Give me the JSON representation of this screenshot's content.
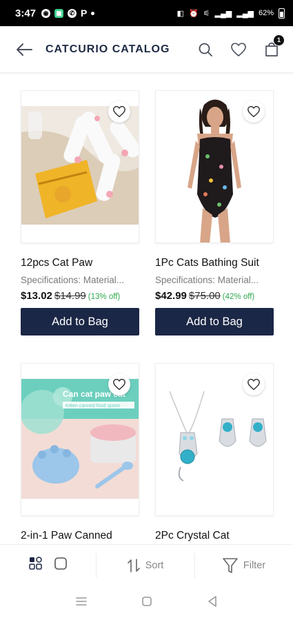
{
  "status_bar": {
    "time": "3:47",
    "left_icons": [
      "facebook-messenger-icon",
      "chat-icon",
      "whatsapp-icon"
    ],
    "p_label": "P",
    "battery": "62%"
  },
  "header": {
    "title": "CATCURIO CATALOG",
    "cart_count": "1"
  },
  "products": [
    {
      "name": "12pcs Cat Paw",
      "spec": "Specifications: Material...",
      "price": "$13.02",
      "old_price": "$14.99",
      "discount": "(13% off)",
      "button": "Add to Bag"
    },
    {
      "name": "1Pc Cats Bathing Suit",
      "spec": "Specifications: Material...",
      "price": "$42.99",
      "old_price": "$75.00",
      "discount": "(42% off)",
      "button": "Add to Bag"
    },
    {
      "name": "2-in-1 Paw Canned",
      "image_text": "Can cat paw cat",
      "image_subtext": "Kitten canned food spoon"
    },
    {
      "name": "2Pc Crystal Cat"
    }
  ],
  "action_bar": {
    "sort_label": "Sort",
    "filter_label": "Filter"
  },
  "colors": {
    "primary": "#1b2746",
    "discount": "#2ea84e",
    "text_muted": "#7a7a7a"
  }
}
